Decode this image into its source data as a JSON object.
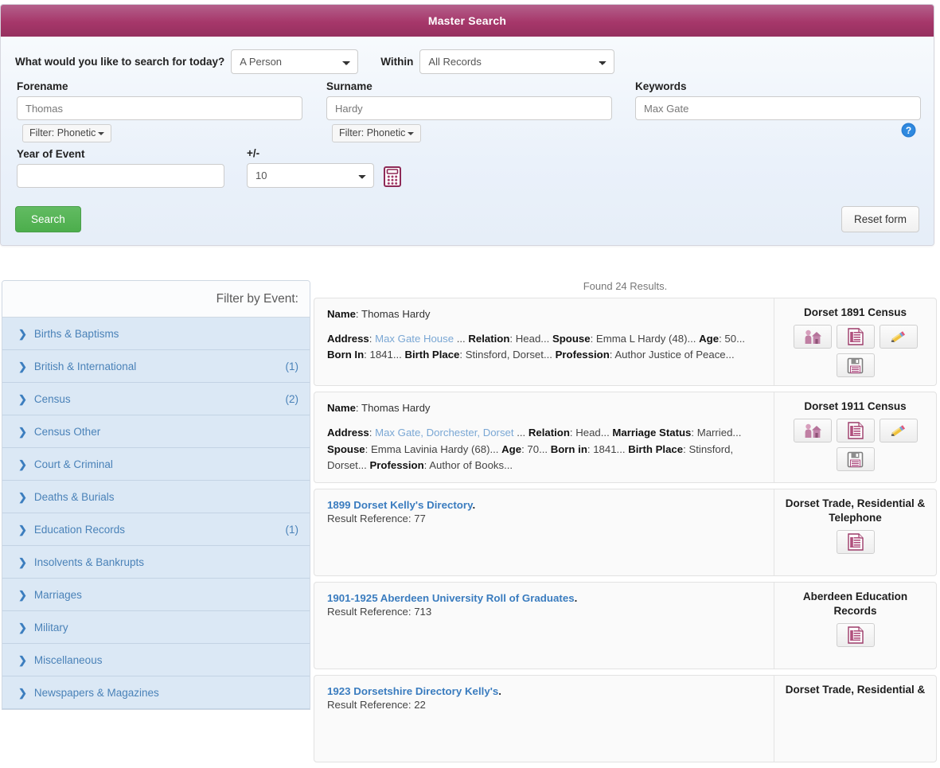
{
  "panel": {
    "title": "Master Search",
    "question_label": "What would you like to search for today?",
    "search_type": "A Person",
    "within_label": "Within",
    "within_value": "All Records",
    "forename_label": "Forename",
    "forename_value": "Thomas",
    "surname_label": "Surname",
    "surname_value": "Hardy",
    "keywords_label": "Keywords",
    "keywords_value": "Max Gate",
    "forename_filter": "Filter: Phonetic",
    "surname_filter": "Filter: Phonetic",
    "year_label": "Year of Event",
    "year_value": "",
    "plusminus_label": "+/-",
    "plusminus_value": "10",
    "calculator_icon": "calculator-icon",
    "help_icon": "help-icon",
    "search_button": "Search",
    "reset_button": "Reset form",
    "accent_color": "#a6376a",
    "search_button_color": "#4cae4c"
  },
  "sidebar": {
    "header": "Filter by Event:",
    "items": [
      {
        "label": "Births & Baptisms",
        "count": ""
      },
      {
        "label": "British & International",
        "count": "(1)"
      },
      {
        "label": "Census",
        "count": "(2)"
      },
      {
        "label": "Census Other",
        "count": ""
      },
      {
        "label": "Court & Criminal",
        "count": ""
      },
      {
        "label": "Deaths & Burials",
        "count": ""
      },
      {
        "label": "Education Records",
        "count": "(1)"
      },
      {
        "label": "Insolvents & Bankrupts",
        "count": ""
      },
      {
        "label": "Marriages",
        "count": ""
      },
      {
        "label": "Military",
        "count": ""
      },
      {
        "label": "Miscellaneous",
        "count": ""
      },
      {
        "label": "Newspapers & Magazines",
        "count": ""
      }
    ]
  },
  "results": {
    "found_text": "Found 24 Results.",
    "items": [
      {
        "kind": "person",
        "name_label": "Name",
        "name_value": "Thomas Hardy",
        "details": [
          {
            "label": "Address",
            "value": "Max Gate House",
            "link": true
          },
          {
            "label": "Relation",
            "value": "Head"
          },
          {
            "label": "Spouse",
            "value": "Emma L Hardy (48)"
          },
          {
            "label": "Age",
            "value": "50"
          },
          {
            "label": "Born In",
            "value": "1841"
          },
          {
            "label": "Birth Place",
            "value": "Stinsford, Dorset"
          },
          {
            "label": "Profession",
            "value": "Author Justice of Peace"
          }
        ],
        "source": "Dorset 1891 Census",
        "icons": [
          "household-icon",
          "records-icon",
          "edit-pencil-icon",
          "save-icon"
        ]
      },
      {
        "kind": "person",
        "name_label": "Name",
        "name_value": "Thomas Hardy",
        "details": [
          {
            "label": "Address",
            "value": "Max Gate, Dorchester, Dorset",
            "link": true
          },
          {
            "label": "Relation",
            "value": "Head"
          },
          {
            "label": "Marriage Status",
            "value": "Married"
          },
          {
            "label": "Spouse",
            "value": "Emma Lavinia Hardy (68)"
          },
          {
            "label": "Age",
            "value": "70"
          },
          {
            "label": "Born in",
            "value": "1841"
          },
          {
            "label": "Birth Place",
            "value": "Stinsford, Dorset"
          },
          {
            "label": "Profession",
            "value": "Author of Books"
          }
        ],
        "source": "Dorset 1911 Census",
        "icons": [
          "household-icon",
          "records-icon",
          "edit-pencil-icon",
          "save-icon"
        ]
      },
      {
        "kind": "directory",
        "title": "1899 Dorset Kelly's Directory",
        "reference_label": "Result Reference",
        "reference_value": "77",
        "source": "Dorset Trade, Residential & Telephone",
        "icons": [
          "records-icon"
        ]
      },
      {
        "kind": "directory",
        "title": "1901-1925 Aberdeen University Roll of Graduates",
        "reference_label": "Result Reference",
        "reference_value": "713",
        "source": "Aberdeen Education Records",
        "icons": [
          "records-icon"
        ]
      },
      {
        "kind": "directory",
        "title": "1923 Dorsetshire Directory Kelly's",
        "reference_label": "Result Reference",
        "reference_value": "22",
        "source": "Dorset Trade, Residential &",
        "icons": []
      }
    ]
  }
}
